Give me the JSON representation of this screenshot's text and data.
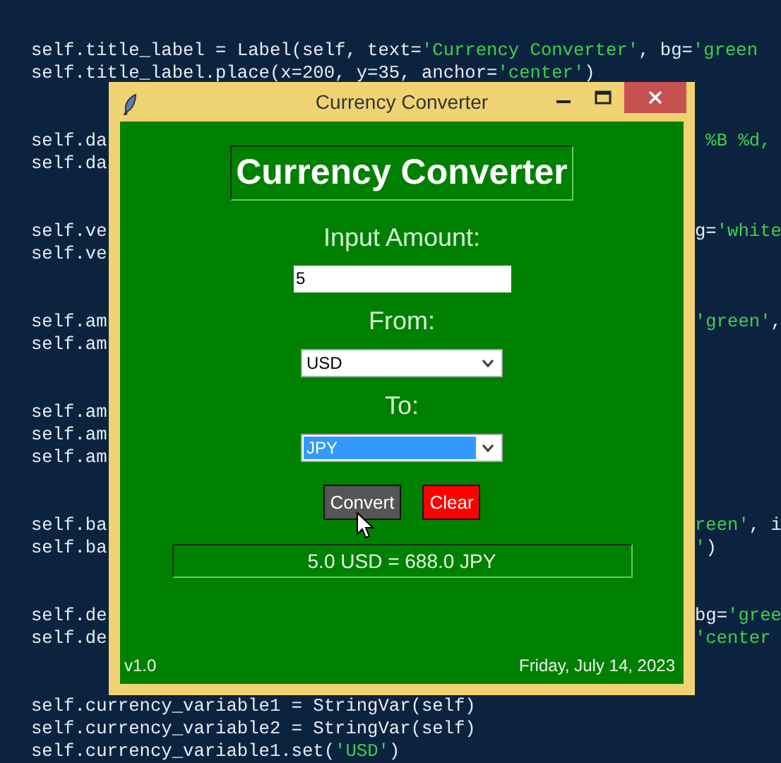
{
  "editor": {
    "lines": [
      {
        "kind": "code",
        "left": [
          {
            "text": "self.title_label = Label(self, text=",
            "kind": "plain"
          },
          {
            "text": "'Currency Converter'",
            "kind": "string"
          },
          {
            "text": ", bg=",
            "kind": "plain"
          },
          {
            "text": "'green",
            "kind": "string"
          }
        ]
      },
      {
        "kind": "code",
        "left": [
          {
            "text": "self.title_label.place(x=200, y=35, anchor=",
            "kind": "plain"
          },
          {
            "text": "'center'",
            "kind": "string"
          },
          {
            "text": ")",
            "kind": "plain"
          }
        ]
      },
      {
        "kind": "blank"
      },
      {
        "kind": "blank"
      },
      {
        "kind": "code",
        "left": [
          {
            "text": "self.da",
            "kind": "plain"
          }
        ],
        "right": [
          {
            "text": " %B %d,",
            "kind": "string"
          }
        ]
      },
      {
        "kind": "code",
        "left": [
          {
            "text": "self.da",
            "kind": "plain"
          }
        ]
      },
      {
        "kind": "blank"
      },
      {
        "kind": "blank"
      },
      {
        "kind": "code",
        "left": [
          {
            "text": "self.ve",
            "kind": "plain"
          }
        ],
        "right": [
          {
            "text": "g=",
            "kind": "plain"
          },
          {
            "text": "'white",
            "kind": "string"
          }
        ]
      },
      {
        "kind": "code",
        "left": [
          {
            "text": "self.ve",
            "kind": "plain"
          }
        ]
      },
      {
        "kind": "blank"
      },
      {
        "kind": "blank"
      },
      {
        "kind": "code",
        "left": [
          {
            "text": "self.am",
            "kind": "plain"
          }
        ],
        "right": [
          {
            "text": "'green'",
            "kind": "string"
          },
          {
            "text": ",",
            "kind": "plain"
          }
        ]
      },
      {
        "kind": "code",
        "left": [
          {
            "text": "self.am",
            "kind": "plain"
          }
        ]
      },
      {
        "kind": "blank"
      },
      {
        "kind": "blank"
      },
      {
        "kind": "code",
        "left": [
          {
            "text": "self.am",
            "kind": "plain"
          }
        ]
      },
      {
        "kind": "code",
        "left": [
          {
            "text": "self.am",
            "kind": "plain"
          }
        ]
      },
      {
        "kind": "code",
        "left": [
          {
            "text": "self.am",
            "kind": "plain"
          }
        ]
      },
      {
        "kind": "blank"
      },
      {
        "kind": "blank"
      },
      {
        "kind": "code",
        "left": [
          {
            "text": "self.ba",
            "kind": "plain"
          }
        ],
        "right": [
          {
            "text": "reen'",
            "kind": "string"
          },
          {
            "text": ", i",
            "kind": "plain"
          }
        ]
      },
      {
        "kind": "code",
        "left": [
          {
            "text": "self.ba",
            "kind": "plain"
          }
        ],
        "right": [
          {
            "text": "'",
            "kind": "string"
          },
          {
            "text": ")",
            "kind": "plain"
          }
        ]
      },
      {
        "kind": "blank"
      },
      {
        "kind": "blank"
      },
      {
        "kind": "code",
        "left": [
          {
            "text": "self.de",
            "kind": "plain"
          }
        ],
        "right": [
          {
            "text": "bg=",
            "kind": "plain"
          },
          {
            "text": "'gree",
            "kind": "string"
          }
        ]
      },
      {
        "kind": "code",
        "left": [
          {
            "text": "self.de",
            "kind": "plain"
          }
        ],
        "right": [
          {
            "text": "'center",
            "kind": "string"
          }
        ]
      },
      {
        "kind": "blank"
      },
      {
        "kind": "blank"
      },
      {
        "kind": "code",
        "left": [
          {
            "text": "self.currency_variable1 = StringVar(self)",
            "kind": "plain"
          }
        ]
      },
      {
        "kind": "code",
        "left": [
          {
            "text": "self.currency_variable2 = StringVar(self)",
            "kind": "plain"
          }
        ]
      },
      {
        "kind": "code",
        "left": [
          {
            "text": "self.currency_variable1.set(",
            "kind": "plain"
          },
          {
            "text": "'USD'",
            "kind": "string"
          },
          {
            "text": ")",
            "kind": "plain"
          }
        ]
      }
    ]
  },
  "window": {
    "title": "Currency Converter",
    "heading": "Currency Converter",
    "amount": {
      "label": "Input Amount:",
      "value": "5"
    },
    "dropdowns": [
      {
        "label": "From:",
        "value": "USD",
        "highlighted": false
      },
      {
        "label": "To:",
        "value": "JPY",
        "highlighted": true
      }
    ],
    "buttons": [
      {
        "label": "Convert",
        "kind": "convert"
      },
      {
        "label": "Clear",
        "kind": "clear"
      }
    ],
    "result": "5.0 USD = 688.0 JPY",
    "version": "v1.0",
    "date": "Friday, July 14, 2023"
  }
}
